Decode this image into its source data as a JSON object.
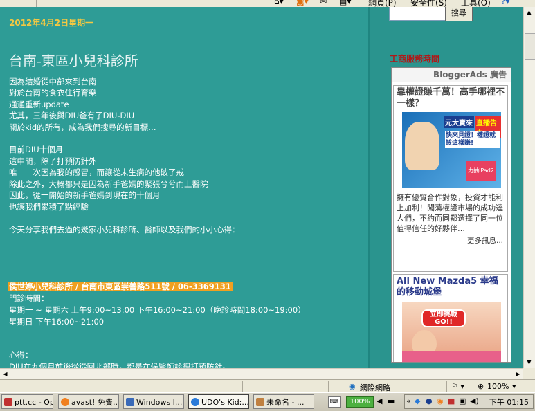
{
  "toolbar": {
    "webpage_label": "網頁(P)",
    "safety_label": "安全性(S)",
    "tools_label": "工具(O)"
  },
  "blog": {
    "date": "2012年4月2日星期一",
    "title": "台南-東區小兒科診所",
    "lines": [
      "因為結婚從中部來到台南",
      "對於台南的食衣住行育樂",
      "通通重新update",
      "尤其，三年後與DIU爸有了DIU-DIU",
      "關於kid的所有，成為我們搜尋的新目標…",
      "",
      "目前DIU十個月",
      "這中間，除了打預防針外",
      "唯一一次因為我的感冒，而讓從未生病的他破了戒",
      "除此之外，大概都只是因為新手爸媽的緊張兮兮而上醫院",
      "因此，從一開始的新手爸媽到現在的十個月",
      "也讓我們累積了點經驗",
      "",
      "今天分享我們去過的幾家小兒科診所、醫師以及我們的小小心得："
    ],
    "clinic_heading": "侯世婷小兒科診所 / 台南市東區崇善路511號 / 06-3369131",
    "hours_label": "門診時間：",
    "hours_weekday": "星期一 ~ 星期六  上午9:00~13:00  下午16:00~21:00（晚診時間18:00~19:00）",
    "hours_sunday": "星期日  下午16:00~21:00",
    "notes_label": "心得：",
    "notes_partial": "DIU在九個月前後從從回北部時，都是在侯醫師診裡打預防針。"
  },
  "sidebar": {
    "search_button": "搜尋",
    "heading": "工商服務時間",
    "ads_header": "BloggerAds 廣告",
    "ad1": {
      "title": "靠權證賺千萬！高手哪裡不一樣？",
      "img_text1": "元大寶來",
      "img_text2": "直播告白",
      "img_text3": "快來見證！權證就該這樣賺!",
      "img_text4": "力抽iPad2",
      "body": "擁有優質合作對象，投資才能利上加利！闖蕩權證市場的成功達人們，不約而同都選擇了同一位值得信任的好夥伴…",
      "more": "更多訊息..."
    },
    "ad2": {
      "title": "All New Mazda5 幸福的移動城堡",
      "img_text": "立即挑戰 GO!!"
    }
  },
  "statusbar": {
    "zone": "網際網路",
    "zoom": "100%"
  },
  "taskbar": {
    "tasks": [
      "ptt.cc - Ope...",
      "avast! 免費...",
      "Windows I...",
      "UDO's Kid:...",
      "未命名 - ..."
    ],
    "zoom_badge": "100%",
    "clock": "下午 01:15"
  },
  "colors": {
    "page_bg": "#2e9c96",
    "date_color": "#f4c842",
    "highlight": "#f0a020",
    "sidebar_heading": "#b01818"
  }
}
